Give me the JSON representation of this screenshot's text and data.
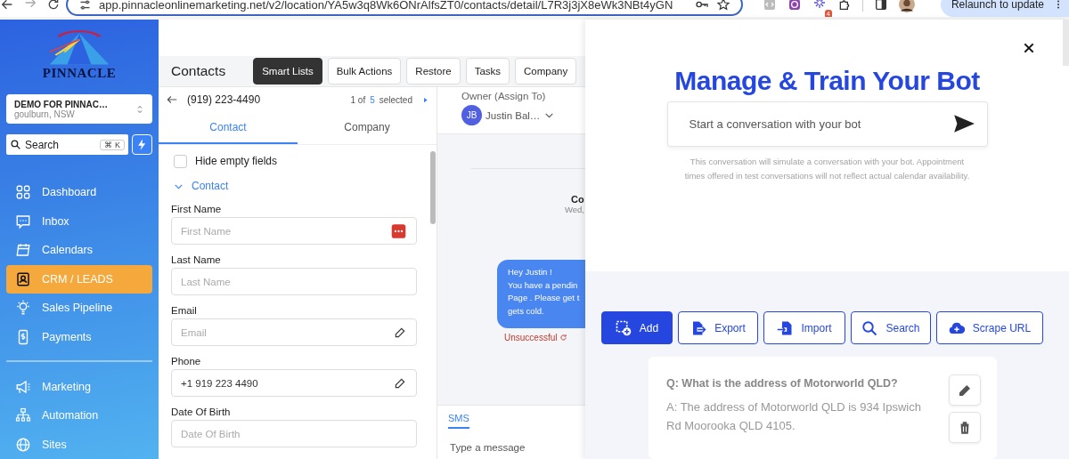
{
  "browser": {
    "url": "app.pinnacleonlinemarketing.net/v2/location/YA5w3q8Wk6ONrAlfsZT0/contacts/detail/L7R3j3jX8eWk3NBt4yGN",
    "extension_badge": "4",
    "relaunch_button": "Relaunch to update"
  },
  "sidebar": {
    "logo_text": "PINNACLE",
    "location": {
      "name": "DEMO FOR PINNAC…",
      "city": "goulburn, NSW"
    },
    "search": {
      "placeholder": "Search",
      "shortcut": "⌘ K"
    },
    "nav_groups": [
      [
        {
          "label": "Dashboard",
          "selected": false
        },
        {
          "label": "Inbox",
          "selected": false
        },
        {
          "label": "Calendars",
          "selected": false
        },
        {
          "label": "CRM / LEADS",
          "selected": true
        },
        {
          "label": "Sales Pipeline",
          "selected": false
        },
        {
          "label": "Payments",
          "selected": false
        }
      ],
      [
        {
          "label": "Marketing",
          "selected": false
        },
        {
          "label": "Automation",
          "selected": false
        },
        {
          "label": "Sites",
          "selected": false
        }
      ]
    ]
  },
  "contacts": {
    "title": "Contacts",
    "actions": [
      {
        "label": "Smart Lists",
        "selected": true
      },
      {
        "label": "Bulk Actions",
        "selected": false
      },
      {
        "label": "Restore",
        "selected": false
      },
      {
        "label": "Tasks",
        "selected": false
      },
      {
        "label": "Company",
        "selected": false
      }
    ],
    "record": {
      "phone": "(919) 223-4490",
      "position": "1 of",
      "count": "5",
      "count_label": "selected"
    },
    "tabs": [
      {
        "label": "Contact",
        "selected": true
      },
      {
        "label": "Company",
        "selected": false
      }
    ],
    "hide_empty": {
      "label": "Hide empty fields",
      "checked": false
    },
    "section": {
      "title": "Contact",
      "expanded": true
    },
    "fields": [
      {
        "label": "First Name",
        "placeholder": "First Name",
        "kind": "menu"
      },
      {
        "label": "Last Name",
        "placeholder": "Last Name",
        "kind": "plain"
      },
      {
        "label": "Email",
        "placeholder": "Email",
        "kind": "edit"
      },
      {
        "label": "Phone",
        "value": "+1 919 223 4490",
        "kind": "edit"
      },
      {
        "label": "Date Of Birth",
        "placeholder": "Date Of Birth",
        "kind": "plain"
      }
    ],
    "owner": {
      "label": "Owner (Assign To)",
      "initials": "JB",
      "name": "Justin Bal…"
    },
    "conversation": {
      "heading": "Co",
      "date": "Wed,",
      "message": "Hey Justin !\nYou have a pendin\nPage . Please get t\ngets cold.",
      "status": "Unsuccessful",
      "channel_tab": {
        "label": "SMS",
        "selected": true
      },
      "composer": {
        "placeholder": "Type a message"
      }
    }
  },
  "bot": {
    "title": "Manage & Train Your Bot",
    "chat_input": {
      "placeholder": "Start a conversation with your bot"
    },
    "disclaimer": "This conversation will simulate a conversation with your bot. Appointment times offered in test conversations will not reflect actual calendar availability.",
    "toolbar": [
      {
        "label": "Add",
        "primary": true
      },
      {
        "label": "Export",
        "primary": false
      },
      {
        "label": "Import",
        "primary": false
      },
      {
        "label": "Search",
        "primary": false
      },
      {
        "label": "Scrape URL",
        "primary": false
      }
    ],
    "faqs": [
      {
        "question": "Q: What is the address of Motorworld QLD?",
        "answer": "A: The address of Motorworld QLD is 934 Ipswich Rd Moorooka QLD 4105."
      }
    ]
  }
}
